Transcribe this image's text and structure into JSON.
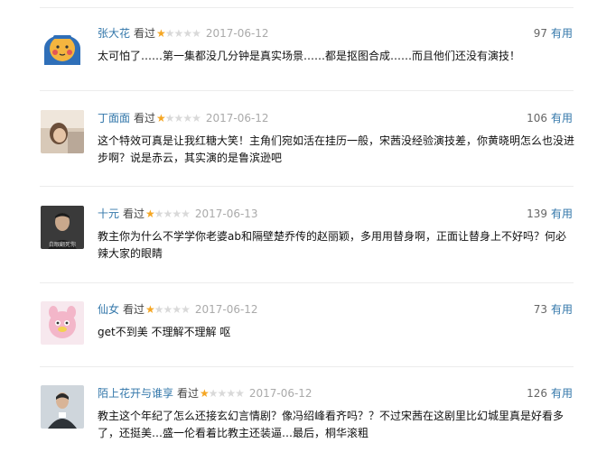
{
  "comments": [
    {
      "user": "张大花",
      "action": "看过",
      "rating": 1,
      "date": "2017-06-12",
      "votes": "97",
      "useful_label": "有用",
      "text": "太可怕了……第一集都没几分钟是真实场景……都是抠图合成……而且他们还没有演技！",
      "avatar": "cartoon-face-avatar"
    },
    {
      "user": "丁面面",
      "action": "看过",
      "rating": 1,
      "date": "2017-06-12",
      "votes": "106",
      "useful_label": "有用",
      "text": "这个特效可真是让我红糖大笑！主角们宛如活在挂历一般，宋茜没经验演技差，你黄晓明怎么也没进步啊？说是赤云，其实演的是鲁滨逊吧",
      "avatar": "photo-avatar"
    },
    {
      "user": "十元",
      "action": "看过",
      "rating": 1,
      "date": "2017-06-13",
      "votes": "139",
      "useful_label": "有用",
      "text": "教主你为什么不学学你老婆ab和隔壁楚乔传的赵丽颖，多用用替身啊，正面让替身上不好吗？何必辣大家的眼睛",
      "avatar": "photo-avatar",
      "avatar_caption": "白眼翻死你"
    },
    {
      "user": "仙女",
      "action": "看过",
      "rating": 1,
      "date": "2017-06-12",
      "votes": "73",
      "useful_label": "有用",
      "text": "get不到美 不理解不理解 呕",
      "avatar": "pink-plush-avatar"
    },
    {
      "user": "陌上花开与谁享",
      "action": "看过",
      "rating": 1,
      "date": "2017-06-12",
      "votes": "126",
      "useful_label": "有用",
      "text": "教主这个年纪了怎么还接玄幻言情剧？像冯绍峰看齐吗？？不过宋茜在这剧里比幻城里真是好看多了，还挺美…盛一伦看着比教主还装逼…最后，桐华滚粗",
      "avatar": "photo-avatar"
    }
  ],
  "colors": {
    "link": "#3377aa",
    "star_on": "#f5a623",
    "star_off": "#d9d9d9",
    "date": "#aaaaaa"
  }
}
